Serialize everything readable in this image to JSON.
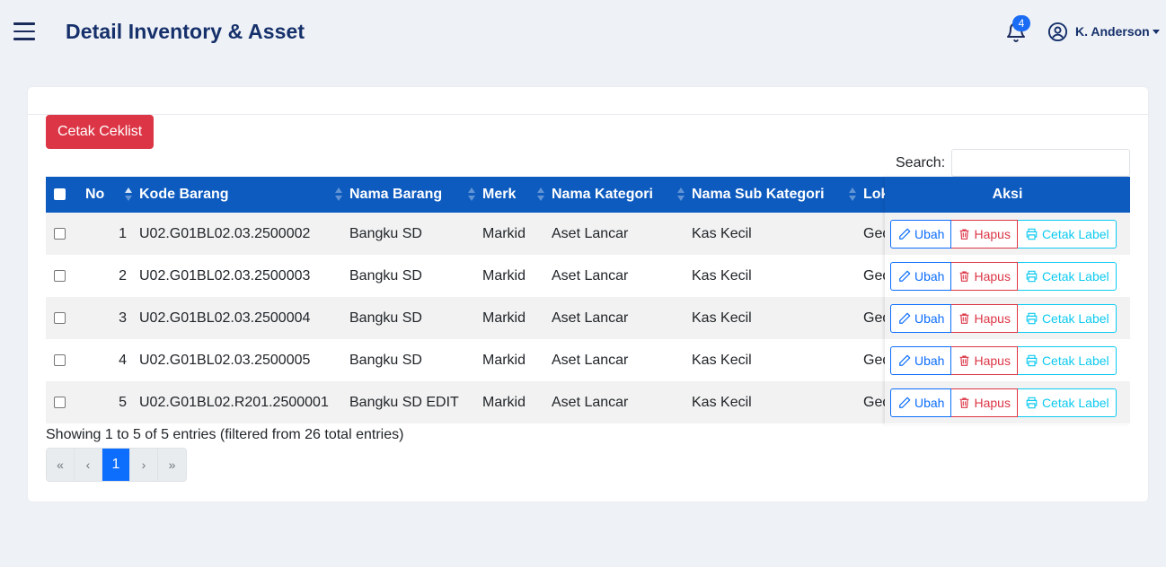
{
  "header": {
    "title": "Detail Inventory & Asset",
    "notification_count": "4",
    "user_name": "K. Anderson"
  },
  "toolbar": {
    "print_checklist_label": "Cetak Ceklist",
    "search_label": "Search:",
    "search_value": ""
  },
  "table": {
    "columns": [
      "No",
      "Kode Barang",
      "Nama Barang",
      "Merk",
      "Nama Kategori",
      "Nama Sub Kategori",
      "Lok",
      "Aksi"
    ],
    "rows": [
      {
        "no": "1",
        "kode": "U02.G01BL02.03.2500002",
        "nama": "Bangku SD",
        "merk": "Markid",
        "kategori": "Aset Lancar",
        "sub": "Kas Kecil",
        "lok": "Ged"
      },
      {
        "no": "2",
        "kode": "U02.G01BL02.03.2500003",
        "nama": "Bangku SD",
        "merk": "Markid",
        "kategori": "Aset Lancar",
        "sub": "Kas Kecil",
        "lok": "Ged"
      },
      {
        "no": "3",
        "kode": "U02.G01BL02.03.2500004",
        "nama": "Bangku SD",
        "merk": "Markid",
        "kategori": "Aset Lancar",
        "sub": "Kas Kecil",
        "lok": "Ged"
      },
      {
        "no": "4",
        "kode": "U02.G01BL02.03.2500005",
        "nama": "Bangku SD",
        "merk": "Markid",
        "kategori": "Aset Lancar",
        "sub": "Kas Kecil",
        "lok": "Ged"
      },
      {
        "no": "5",
        "kode": "U02.G01BL02.R201.2500001",
        "nama": "Bangku SD EDIT",
        "merk": "Markid",
        "kategori": "Aset Lancar",
        "sub": "Kas Kecil",
        "lok": "Ged"
      }
    ],
    "actions": {
      "edit_label": "Ubah",
      "delete_label": "Hapus",
      "print_label": "Cetak Label"
    }
  },
  "footer": {
    "info": "Showing 1 to 5 of 5 entries (filtered from 26 total entries)",
    "pager": [
      "«",
      "‹",
      "1",
      "›",
      "»"
    ],
    "current_page": "1"
  },
  "colors": {
    "header_blue": "#0d5bbf",
    "danger": "#dc3545",
    "primary": "#0d6efd",
    "info": "#0dcaf0",
    "title": "#15306a"
  }
}
